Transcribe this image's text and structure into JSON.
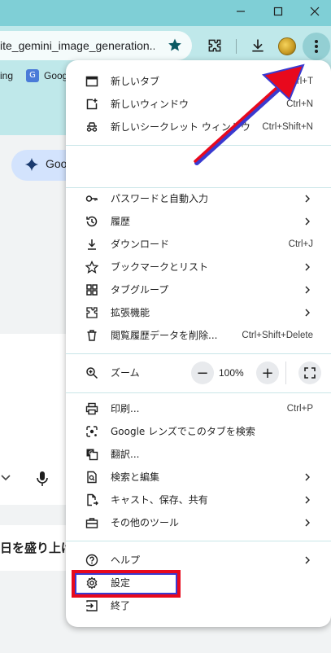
{
  "window": {
    "minimize_icon": "minimize-icon",
    "maximize_icon": "maximize-icon",
    "close_icon": "close-icon"
  },
  "toolbar": {
    "url": "ite_gemini_image_generation...",
    "bookmark_icon": "star-icon"
  },
  "bookmarks": {
    "items": [
      "ing",
      "Goog"
    ]
  },
  "page": {
    "gemini_pill_label": "Goo",
    "fragment_text": "日を盛り上げ"
  },
  "menu": {
    "group1": [
      {
        "label": "新しいタブ",
        "shortcut": "Ctrl+T",
        "icon": "new-tab-icon"
      },
      {
        "label": "新しいウィンドウ",
        "shortcut": "Ctrl+N",
        "icon": "new-window-icon"
      },
      {
        "label": "新しいシークレット ウィンドウ",
        "shortcut": "Ctrl+Shift+N",
        "icon": "incognito-icon"
      }
    ],
    "group2": [
      {
        "label": "パスワードと自動入力",
        "shortcut": "",
        "icon": "key-icon",
        "submenu": true
      },
      {
        "label": "履歴",
        "shortcut": "",
        "icon": "history-icon",
        "submenu": true
      },
      {
        "label": "ダウンロード",
        "shortcut": "Ctrl+J",
        "icon": "download-icon",
        "submenu": false
      },
      {
        "label": "ブックマークとリスト",
        "shortcut": "",
        "icon": "star-outline-icon",
        "submenu": true
      },
      {
        "label": "タブグループ",
        "shortcut": "",
        "icon": "tab-groups-icon",
        "submenu": true
      },
      {
        "label": "拡張機能",
        "shortcut": "",
        "icon": "extension-icon",
        "submenu": true
      },
      {
        "label": "閲覧履歴データを削除...",
        "shortcut": "Ctrl+Shift+Delete",
        "icon": "trash-icon",
        "submenu": false
      }
    ],
    "zoom": {
      "label": "ズーム",
      "value": "100%",
      "minus": "−",
      "plus": "+"
    },
    "group3": [
      {
        "label": "印刷...",
        "shortcut": "Ctrl+P",
        "icon": "print-icon",
        "submenu": false
      },
      {
        "label": "Google レンズでこのタブを検索",
        "shortcut": "",
        "icon": "lens-icon",
        "submenu": false
      },
      {
        "label": "翻訳...",
        "shortcut": "",
        "icon": "translate-icon",
        "submenu": false
      },
      {
        "label": "検索と編集",
        "shortcut": "",
        "icon": "find-icon",
        "submenu": true
      },
      {
        "label": "キャスト、保存、共有",
        "shortcut": "",
        "icon": "cast-save-icon",
        "submenu": true
      },
      {
        "label": "その他のツール",
        "shortcut": "",
        "icon": "toolbox-icon",
        "submenu": true
      }
    ],
    "group4": [
      {
        "label": "ヘルプ",
        "shortcut": "",
        "icon": "help-icon",
        "submenu": true
      },
      {
        "label": "設定",
        "shortcut": "",
        "icon": "settings-icon",
        "submenu": false
      },
      {
        "label": "終了",
        "shortcut": "",
        "icon": "exit-icon",
        "submenu": false
      }
    ]
  },
  "colors": {
    "chrome_teal": "#bfe8ea",
    "titlebar": "#7fcfd6",
    "annotation_red": "#e8091d",
    "annotation_blue": "#3a3ad0"
  }
}
